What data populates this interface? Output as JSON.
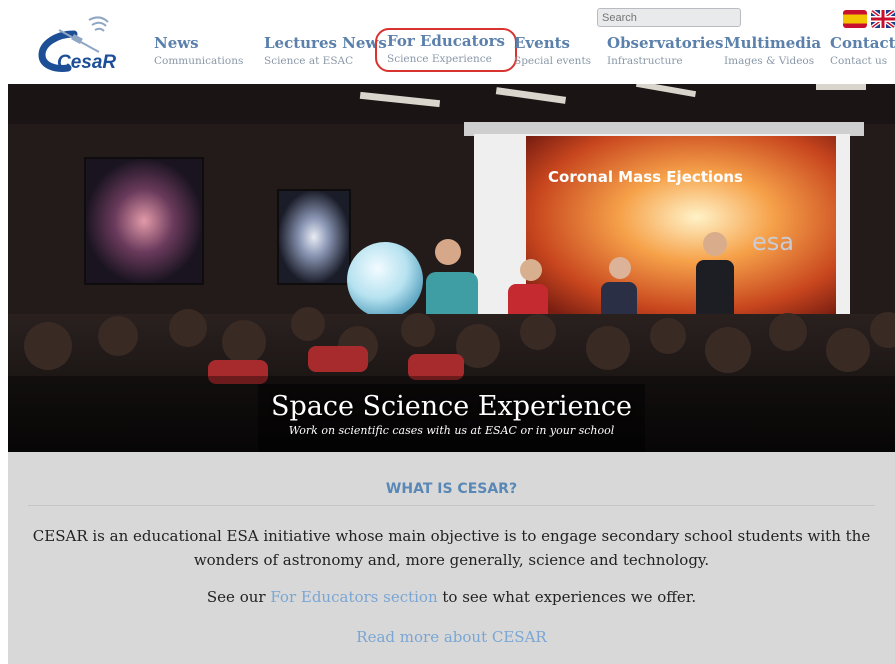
{
  "header": {
    "logo_text": "CesaR",
    "nav": [
      {
        "label": "News",
        "sub": "Communications",
        "active": false
      },
      {
        "label": "Lectures News",
        "sub": "Science at ESAC",
        "active": false
      },
      {
        "label": "For Educators",
        "sub": "Science Experience",
        "active": true
      },
      {
        "label": "Events",
        "sub": "Special events",
        "active": false
      },
      {
        "label": "Observatories",
        "sub": "Infrastructure",
        "active": false
      },
      {
        "label": "Multimedia",
        "sub": "Images & Videos",
        "active": false
      },
      {
        "label": "Contact",
        "sub": "Contact us",
        "active": false
      }
    ],
    "search_placeholder": "Search",
    "languages": [
      "Español",
      "English"
    ]
  },
  "hero": {
    "screen_title": "Coronal Mass Ejections",
    "screen_logo": "esa",
    "title": "Space Science Experience",
    "subtitle": "Work on scientific cases with us at ESAC or in your school"
  },
  "about": {
    "heading": "WHAT IS CESAR?",
    "text": "CESAR is an educational ESA initiative whose main objective is to engage secondary school students with the wonders of astronomy and, more generally, science and technology.",
    "line2_prefix": "See our ",
    "line2_link": "For Educators section",
    "line2_suffix": " to see what experiences we offer.",
    "read_more": "Read more about CESAR"
  },
  "colors": {
    "nav_main": "#5a80ab",
    "active_outline": "#d9332f",
    "link": "#7aa6d4",
    "about_bg": "#d8d8d8"
  }
}
